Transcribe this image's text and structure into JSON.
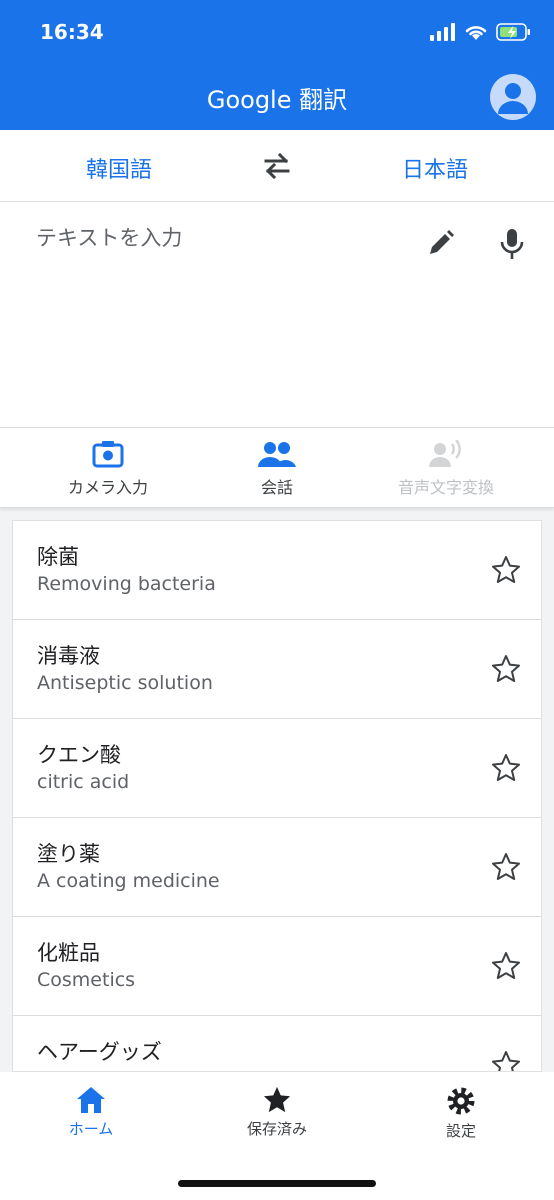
{
  "status_bar": {
    "time": "16:34"
  },
  "header": {
    "title": "Google 翻訳"
  },
  "languages": {
    "source": "韓国語",
    "target": "日本語"
  },
  "input": {
    "placeholder": "テキストを入力"
  },
  "tools": [
    {
      "label": "カメラ入力",
      "icon": "camera-icon",
      "enabled": true
    },
    {
      "label": "会話",
      "icon": "conversation-icon",
      "enabled": true
    },
    {
      "label": "音声文字変換",
      "icon": "transcribe-icon",
      "enabled": false
    }
  ],
  "history": [
    {
      "source": "除菌",
      "translation": "Removing bacteria"
    },
    {
      "source": "消毒液",
      "translation": "Antiseptic solution"
    },
    {
      "source": "クエン酸",
      "translation": "citric acid"
    },
    {
      "source": "塗り薬",
      "translation": "A coating medicine"
    },
    {
      "source": "化粧品",
      "translation": "Cosmetics"
    },
    {
      "source": "ヘアーグッズ",
      "translation": ""
    }
  ],
  "nav": {
    "home": "ホーム",
    "saved": "保存済み",
    "settings": "設定"
  },
  "colors": {
    "brand": "#1a73e8",
    "text": "#202124",
    "secondary": "#5f6368",
    "disabled": "#bdc1c6"
  }
}
